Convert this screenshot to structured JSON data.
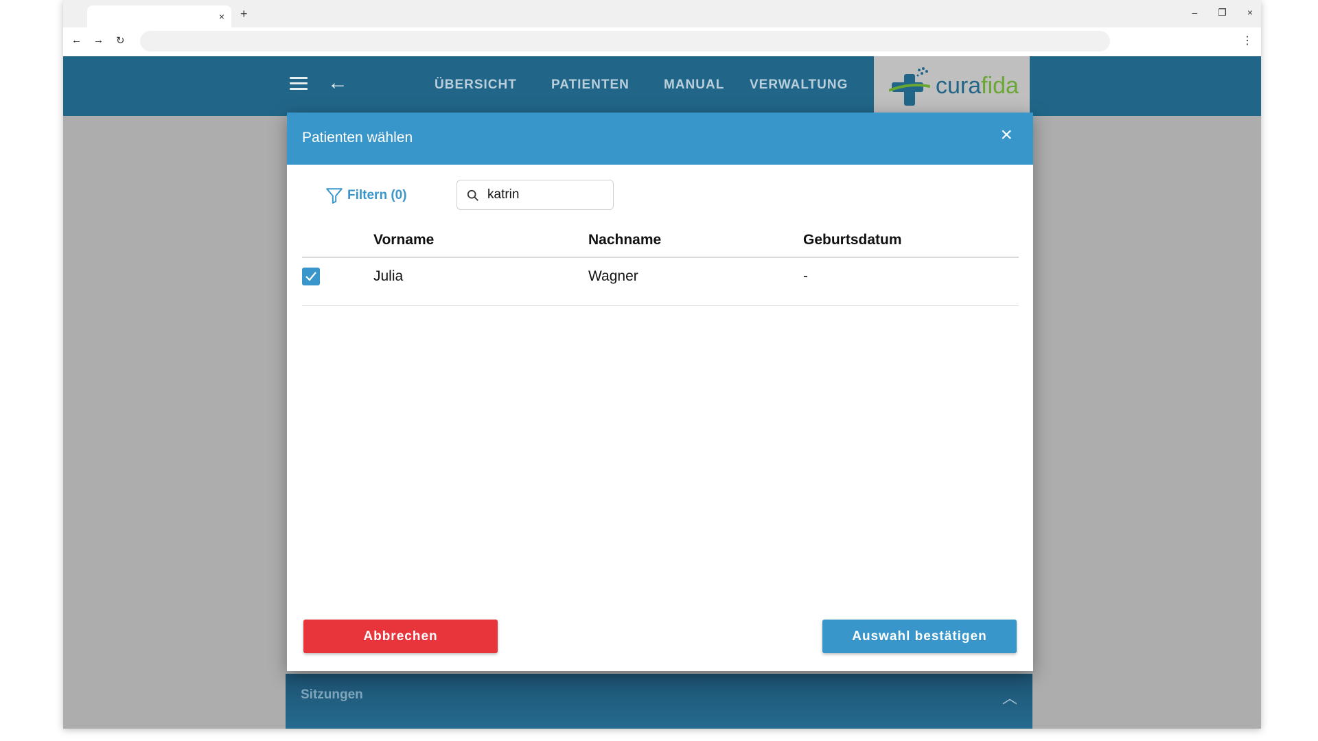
{
  "browser": {
    "tab_close_icon": "×",
    "new_tab_icon": "+",
    "window_controls": {
      "minimize": "–",
      "restore": "❐",
      "close": "×"
    },
    "nav": {
      "back": "←",
      "forward": "→",
      "reload": "↻"
    },
    "menu_icon": "⋮"
  },
  "header": {
    "nav_items": [
      "ÜBERSICHT",
      "PATIENTEN",
      "MANUAL",
      "VERWALTUNG"
    ],
    "logo": {
      "prefix": "cura",
      "suffix": "fida"
    },
    "colors": {
      "bar": "#216689",
      "logo_green": "#6aa732"
    }
  },
  "dialog": {
    "title": "Patienten wählen",
    "close_icon": "×",
    "filter_label": "Filtern (0)",
    "search": {
      "value": "katrin",
      "placeholder": ""
    },
    "columns": [
      "Vorname",
      "Nachname",
      "Geburtsdatum"
    ],
    "rows": [
      {
        "checked": true,
        "vorname": "Julia",
        "nachname": "Wagner",
        "geburtsdatum": "-"
      }
    ],
    "cancel_label": "Abbrechen",
    "confirm_label": "Auswahl bestätigen",
    "colors": {
      "primary": "#3896cb",
      "danger": "#e8353b"
    }
  },
  "background_panel": {
    "title": "Sitzungen",
    "chevron_icon": "︿"
  }
}
